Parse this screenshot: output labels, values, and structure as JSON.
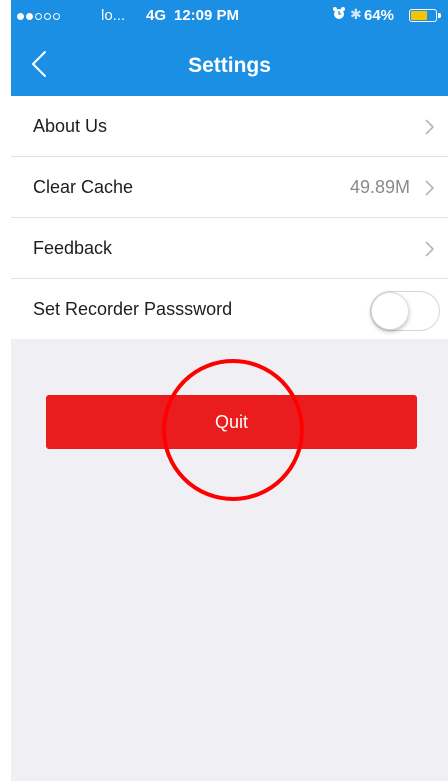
{
  "status_bar": {
    "carrier": "lo...",
    "network": "4G",
    "time": "12:09 PM",
    "battery_percent": "64%",
    "battery_level": 0.64,
    "signal_bars_filled": 2,
    "signal_bars_total": 5,
    "icons": [
      "alarm-icon",
      "bluetooth-icon",
      "battery-icon"
    ]
  },
  "nav": {
    "title": "Settings",
    "back_icon": "chevron-left-icon"
  },
  "settings": {
    "about_label": "About Us",
    "clear_cache_label": "Clear Cache",
    "cache_size": "49.89M",
    "feedback_label": "Feedback",
    "recorder_password_label": "Set Recorder Passsword",
    "recorder_password_enabled": false
  },
  "actions": {
    "quit_label": "Quit"
  },
  "annotation": {
    "type": "circle-highlight",
    "color": "#ff0000"
  },
  "colors": {
    "nav_background": "#1a8fe3",
    "quit_button": "#eb1c1e",
    "page_background": "#efeff4"
  }
}
